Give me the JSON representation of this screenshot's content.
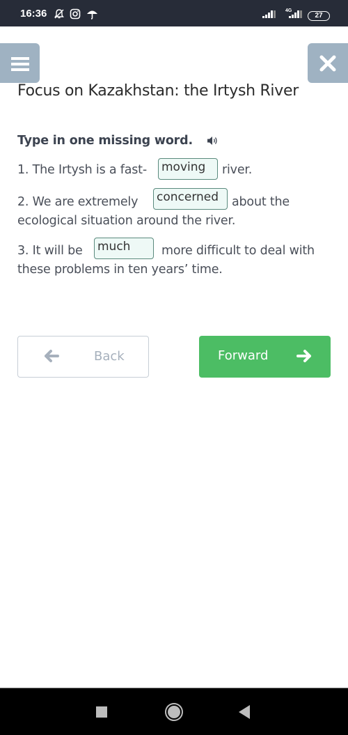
{
  "status_bar": {
    "time": "16:36",
    "network_label": "4G",
    "battery": "27",
    "icons": [
      "bell-off-icon",
      "instagram-icon",
      "umbrella-icon",
      "signal-icon",
      "signal-4g-icon",
      "battery-icon"
    ]
  },
  "header": {
    "menu_icon": "hamburger-icon",
    "close_icon": "close-icon",
    "title": "Focus on Kazakhstan: the Irtysh River"
  },
  "exercise": {
    "instruction": "Type in one missing word.",
    "audio_icon": "speaker-icon",
    "items": [
      {
        "number": "1.",
        "before": "The Irtysh is a fast-",
        "answer": "moving",
        "after": "river.",
        "after_line2": ""
      },
      {
        "number": "2.",
        "before": "We are extremely",
        "answer": "concerned",
        "after": "about the",
        "after_line2": "ecological situation around the river."
      },
      {
        "number": "3.",
        "before": "It will be",
        "answer": "much",
        "after": "more difficult to deal with",
        "after_line2": "these problems in ten years’ time."
      }
    ]
  },
  "navigation": {
    "back_label": "Back",
    "forward_label": "Forward"
  },
  "colors": {
    "status_bar_bg": "#272c38",
    "header_button_bg": "#9fb2c2",
    "forward_bg": "#4cbd64",
    "input_border": "#5a8a7d",
    "input_bg": "#eef9f6"
  },
  "system_nav": {
    "buttons": [
      "recents-icon",
      "home-icon",
      "back-icon"
    ]
  }
}
